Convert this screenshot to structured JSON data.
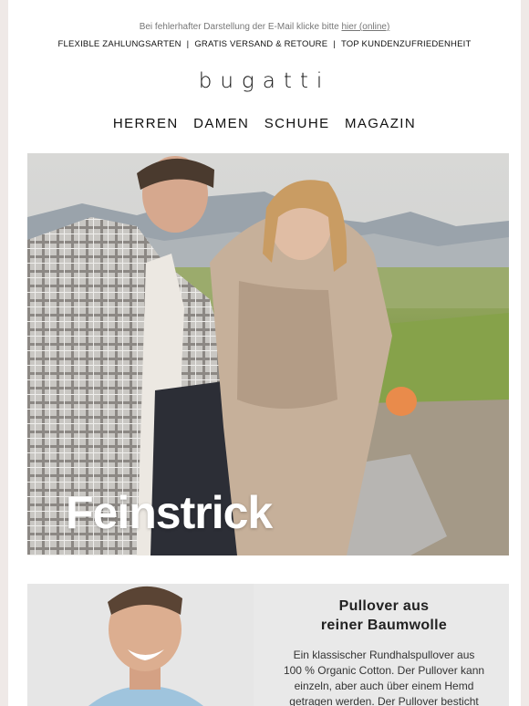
{
  "preheader": {
    "text": "Bei fehlerhafter Darstellung der E-Mail klicke bitte",
    "link": "hier (online)"
  },
  "usp": [
    "FLEXIBLE ZAHLUNGSARTEN",
    "GRATIS VERSAND & RETOURE",
    "TOP KUNDENZUFRIEDENHEIT"
  ],
  "usp_separator": "|",
  "brand": "bugatti",
  "nav": [
    "HERREN",
    "DAMEN",
    "SCHUHE",
    "MAGAZIN"
  ],
  "hero": {
    "title": "Feinstrick"
  },
  "product": {
    "title_line1": "Pullover aus",
    "title_line2": "reiner Baumwolle",
    "desc_line1": "Ein klassischer Rundhalspullover aus",
    "desc_line2": "100 % Organic Cotton. Der Pullover kann",
    "desc_line3": "einzeln, aber auch über einem Hemd",
    "desc_line4": "getragen werden. Der Pullover besticht"
  },
  "colors": {
    "background": "#efe9e7",
    "text": "#111111",
    "hero_title": "#ffffff",
    "product_bg": "#e9e9e9"
  }
}
